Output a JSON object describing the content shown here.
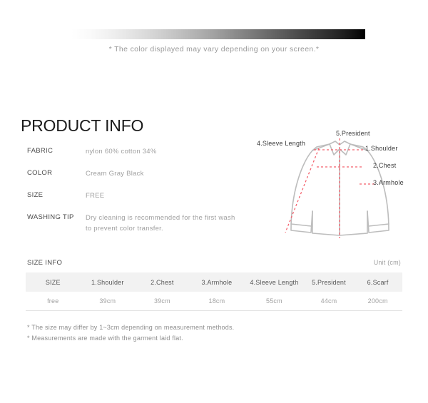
{
  "gradient": {
    "note": "* The color displayed may vary depending on your screen.*",
    "start_color": "#ffffff",
    "end_color": "#000000"
  },
  "page_title": "PRODUCT INFO",
  "spec": {
    "rows": [
      {
        "label": "FABRIC",
        "value": "nylon 60% cotton 34%"
      },
      {
        "label": "COLOR",
        "value": "Cream Gray Black"
      },
      {
        "label": "SIZE",
        "value": "FREE"
      },
      {
        "label": "WASHING TIP",
        "value": "Dry cleaning is recommended for the first wash to prevent color transfer."
      }
    ]
  },
  "diagram": {
    "labels": {
      "president": "5.President",
      "sleeve": "4.Sleeve Length",
      "shoulder": "1.Shoulder",
      "chest": "2.Chest",
      "armhole": "3.Armhole"
    },
    "guide_color": "#f4606c",
    "outline_color": "#b9b9b9"
  },
  "size_info": {
    "title": "SIZE INFO",
    "unit": "Unit (cm)",
    "columns": [
      "SIZE",
      "1.Shoulder",
      "2.Chest",
      "3.Armhole",
      "4.Sleeve Length",
      "5.President",
      "6.Scarf"
    ],
    "rows": [
      [
        "free",
        "39cm",
        "39cm",
        "18cm",
        "55cm",
        "44cm",
        "200cm"
      ]
    ],
    "notes": [
      "* The size may differ by 1~3cm depending on measurement methods.",
      "* Measurements are made with the garment laid flat."
    ]
  }
}
